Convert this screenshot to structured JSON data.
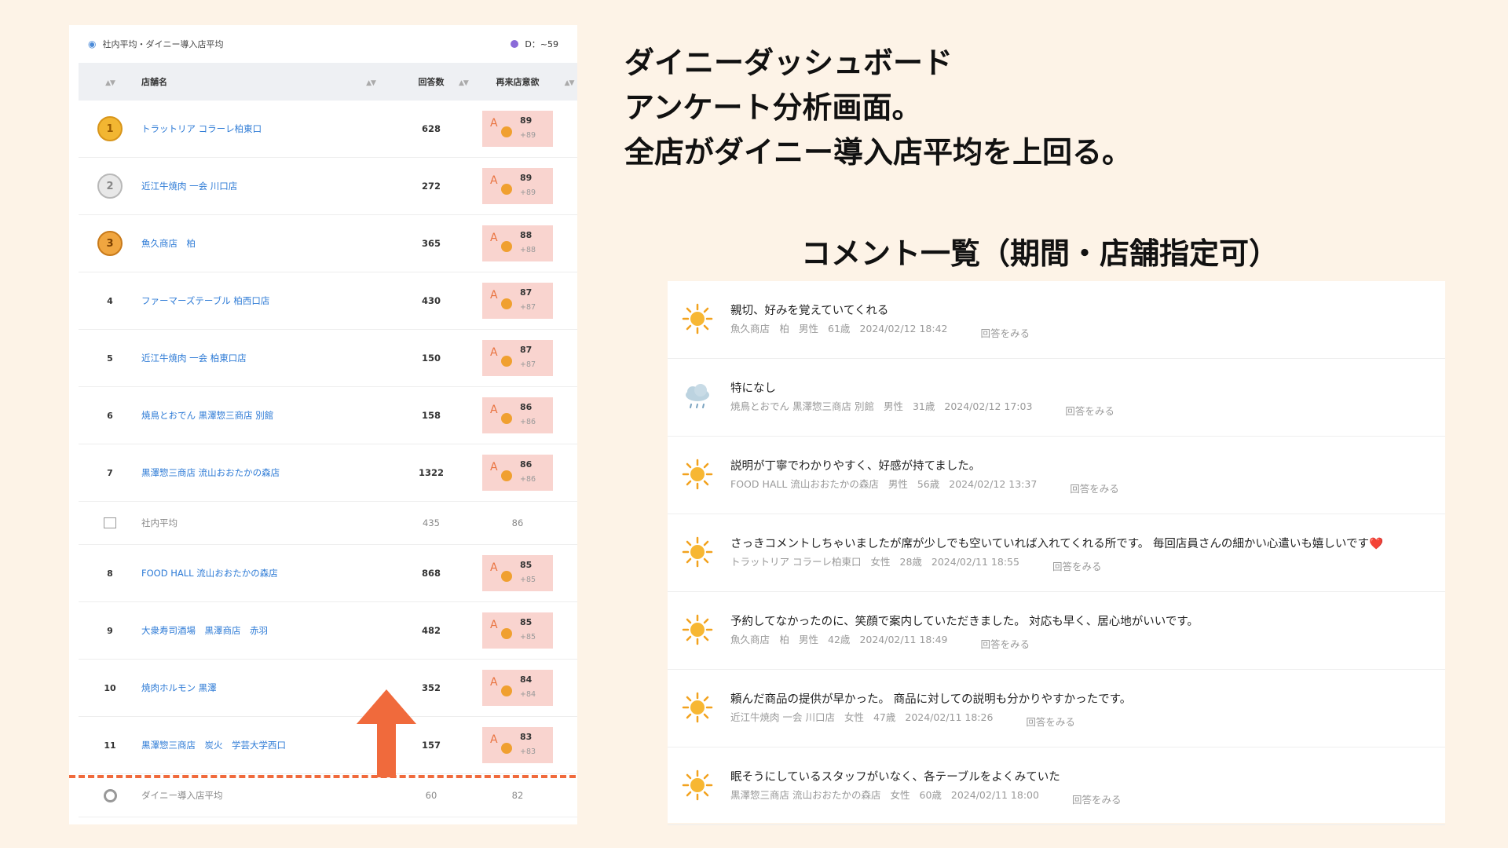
{
  "headline": {
    "line1": "ダイニーダッシュボード",
    "line2": "アンケート分析画面。",
    "line3": "全店がダイニー導入店平均を上回る。"
  },
  "comment_title": "コメント一覧（期間・店舗指定可）",
  "rank_panel": {
    "title": "社内平均・ダイニー導入店平均",
    "d_value": "D：~59",
    "header": {
      "name": "店舗名",
      "count": "回答数",
      "score": "再来店意欲"
    },
    "rows": [
      {
        "rank": "1",
        "medal": "gold",
        "name": "トラットリア コラーレ柏東口",
        "count": "628",
        "grade": "A",
        "score": "89",
        "diff": "+89"
      },
      {
        "rank": "2",
        "medal": "silver",
        "name": "近江牛焼肉 一会 川口店",
        "count": "272",
        "grade": "A",
        "score": "89",
        "diff": "+89"
      },
      {
        "rank": "3",
        "medal": "bronze",
        "name": "魚久商店　柏",
        "count": "365",
        "grade": "A",
        "score": "88",
        "diff": "+88"
      },
      {
        "rank": "4",
        "name": "ファーマーズテーブル 柏西口店",
        "count": "430",
        "grade": "A",
        "score": "87",
        "diff": "+87"
      },
      {
        "rank": "5",
        "name": "近江牛焼肉 一会 柏東口店",
        "count": "150",
        "grade": "A",
        "score": "87",
        "diff": "+87"
      },
      {
        "rank": "6",
        "name": "焼鳥とおでん 黒澤惣三商店 別館",
        "count": "158",
        "grade": "A",
        "score": "86",
        "diff": "+86"
      },
      {
        "rank": "7",
        "name": "黒澤惣三商店 流山おおたかの森店",
        "count": "1322",
        "grade": "A",
        "score": "86",
        "diff": "+86"
      }
    ],
    "avg_company": {
      "name": "社内平均",
      "count": "435",
      "score": "86"
    },
    "rows2": [
      {
        "rank": "8",
        "name": "FOOD HALL 流山おおたかの森店",
        "count": "868",
        "grade": "A",
        "score": "85",
        "diff": "+85"
      },
      {
        "rank": "9",
        "name": "大衆寿司酒場　黒澤商店　赤羽",
        "count": "482",
        "grade": "A",
        "score": "85",
        "diff": "+85"
      },
      {
        "rank": "10",
        "name": "焼肉ホルモン 黒澤",
        "count": "352",
        "grade": "A",
        "score": "84",
        "diff": "+84"
      },
      {
        "rank": "11",
        "name": "黒澤惣三商店　炭火　学芸大学西口",
        "count": "157",
        "grade": "A",
        "score": "83",
        "diff": "+83"
      }
    ],
    "avg_dinii": {
      "name": "ダイニー導入店平均",
      "count": "60",
      "score": "82"
    }
  },
  "comments": [
    {
      "icon": "sun-icon",
      "text": "親切、好みを覚えていてくれる",
      "store": "魚久商店　柏",
      "gender": "男性",
      "age": "61歳",
      "time": "2024/02/12 18:42",
      "reply": "回答をみる"
    },
    {
      "icon": "rain-cloud-icon",
      "text": "特になし",
      "store": "焼鳥とおでん 黒澤惣三商店 別館",
      "gender": "男性",
      "age": "31歳",
      "time": "2024/02/12 17:03",
      "reply": "回答をみる"
    },
    {
      "icon": "sun-icon",
      "text": "説明が丁寧でわかりやすく、好感が持てました。",
      "store": "FOOD HALL 流山おおたかの森店",
      "gender": "男性",
      "age": "56歳",
      "time": "2024/02/12 13:37",
      "reply": "回答をみる"
    },
    {
      "icon": "sun-icon",
      "text": "さっきコメントしちゃいましたが席が少しでも空いていれば入れてくれる所です。 毎回店員さんの細かい心遣いも嬉しいです",
      "heart": "❤️",
      "store": "トラットリア コラーレ柏東口",
      "gender": "女性",
      "age": "28歳",
      "time": "2024/02/11 18:55",
      "reply": "回答をみる"
    },
    {
      "icon": "sun-icon",
      "text": "予約してなかったのに、笑顔で案内していただきました。 対応も早く、居心地がいいです。",
      "store": "魚久商店　柏",
      "gender": "男性",
      "age": "42歳",
      "time": "2024/02/11 18:49",
      "reply": "回答をみる"
    },
    {
      "icon": "sun-icon",
      "text": "頼んだ商品の提供が早かった。 商品に対しての説明も分かりやすかったです。",
      "store": "近江牛焼肉 一会 川口店",
      "gender": "女性",
      "age": "47歳",
      "time": "2024/02/11 18:26",
      "reply": "回答をみる"
    },
    {
      "icon": "sun-icon",
      "text": "眠そうにしているスタッフがいなく、各テーブルをよくみていた",
      "store": "黒澤惣三商店 流山おおたかの森店",
      "gender": "女性",
      "age": "60歳",
      "time": "2024/02/11 18:00",
      "reply": "回答をみる"
    }
  ],
  "colors": {
    "accent": "#f06a3c",
    "link": "#2e7bd6",
    "score_bg": "#f9d4cf",
    "background": "#fdf3e7"
  }
}
